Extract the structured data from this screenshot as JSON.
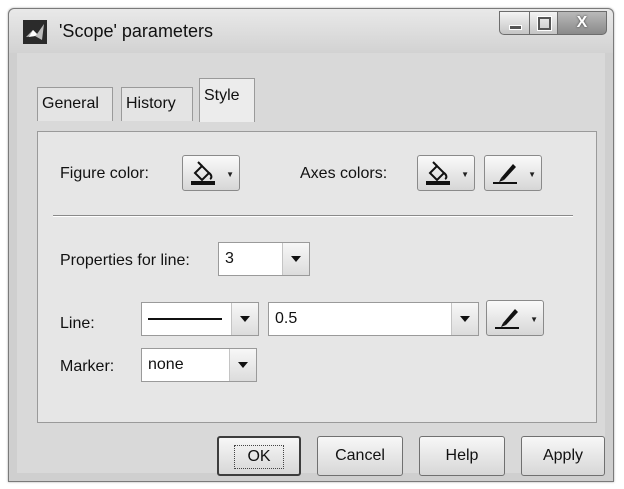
{
  "window": {
    "title": "'Scope' parameters",
    "close_glyph": "X"
  },
  "tabs": [
    {
      "label": "General"
    },
    {
      "label": "History"
    },
    {
      "label": "Style"
    }
  ],
  "style": {
    "figure_color_label": "Figure color:",
    "axes_colors_label": "Axes colors:",
    "properties_for_line_label": "Properties for line:",
    "properties_for_line_value": "3",
    "line_label": "Line:",
    "line_width_value": "0.5",
    "marker_label": "Marker:",
    "marker_value": "none"
  },
  "buttons": {
    "ok": "OK",
    "cancel": "Cancel",
    "help": "Help",
    "apply": "Apply"
  },
  "icons": {
    "app": "matlab-icon",
    "fill_color": "paint-bucket-icon",
    "line_color": "pen-icon",
    "dropdown": "chevron-down-icon"
  }
}
